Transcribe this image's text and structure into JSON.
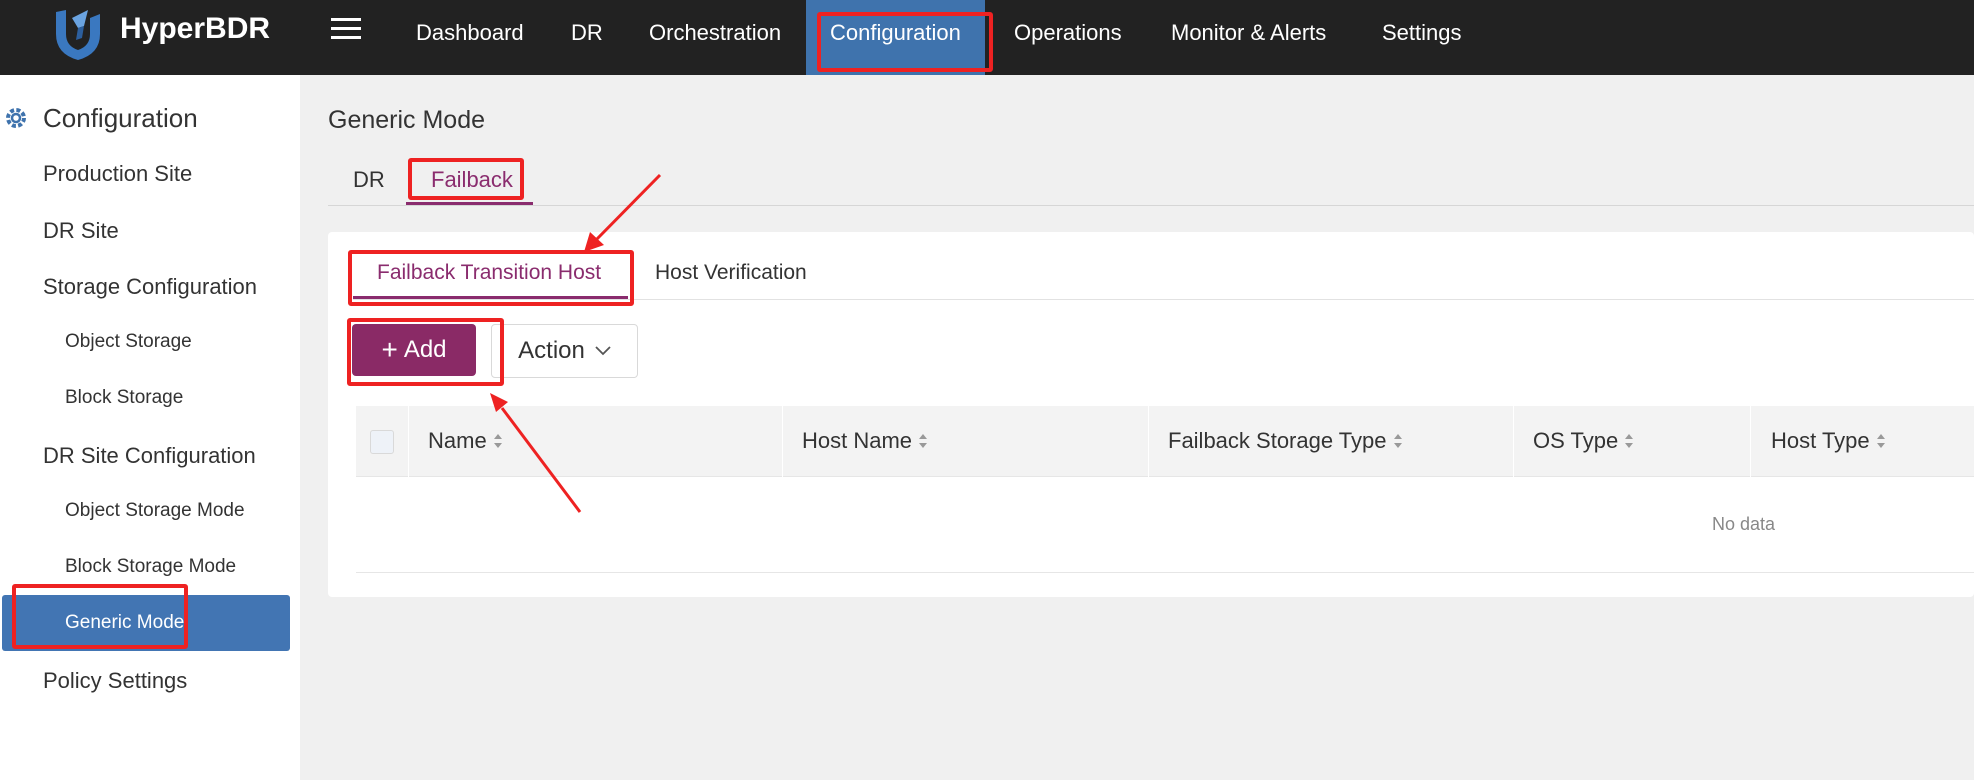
{
  "app": {
    "brand": "HyperBDR"
  },
  "topnav": {
    "items": [
      {
        "label": "Dashboard"
      },
      {
        "label": "DR"
      },
      {
        "label": "Orchestration"
      },
      {
        "label": "Configuration",
        "active": true
      },
      {
        "label": "Operations"
      },
      {
        "label": "Monitor & Alerts"
      },
      {
        "label": "Settings"
      }
    ]
  },
  "sidebar": {
    "header": "Configuration",
    "items": [
      {
        "label": "Production Site"
      },
      {
        "label": "DR Site"
      },
      {
        "label": "Storage Configuration"
      },
      {
        "label": "Object Storage"
      },
      {
        "label": "Block Storage"
      },
      {
        "label": "DR Site Configuration"
      },
      {
        "label": "Object Storage Mode"
      },
      {
        "label": "Block Storage Mode"
      },
      {
        "label": "Generic Mode",
        "active": true
      },
      {
        "label": "Policy Settings"
      }
    ]
  },
  "main": {
    "page_title": "Generic Mode",
    "mode_tabs": [
      {
        "label": "DR"
      },
      {
        "label": "Failback",
        "active": true
      }
    ],
    "sub_tabs": [
      {
        "label": "Failback Transition Host",
        "active": true
      },
      {
        "label": "Host Verification"
      }
    ],
    "toolbar": {
      "add_label": "Add",
      "action_label": "Action"
    },
    "table": {
      "columns": [
        "Name",
        "Host Name",
        "Failback Storage Type",
        "OS Type",
        "Host Type"
      ],
      "empty_text": "No data"
    }
  },
  "colors": {
    "topbar": "#222222",
    "nav_active": "#3f73ad",
    "accent": "#8a2c6e",
    "sidebar_active": "#4275b3",
    "annotation": "#ee2222"
  }
}
